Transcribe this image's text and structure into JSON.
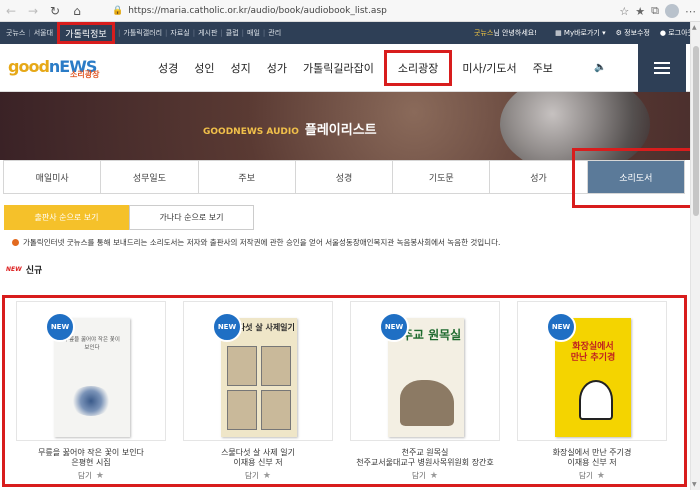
{
  "browser": {
    "url": "https://maria.catholic.or.kr/audio/book/audiobook_list.asp"
  },
  "topbar": {
    "links": [
      "굿뉴스",
      "서울대",
      "",
      "가톨릭갤러리",
      "자료실",
      "게시판",
      "클럽",
      "매일",
      "관리"
    ],
    "highlight": "가톨릭정보",
    "welcome_brand": "굿뉴스",
    "welcome_rest": "님 안녕하세요!",
    "util": [
      "My바로가기",
      "정보수정",
      "로그아웃"
    ]
  },
  "header": {
    "logo_word": "goodnews",
    "logo_sub": "소리광장",
    "menu": [
      "성경",
      "성인",
      "성지",
      "성가",
      "가톨릭길라잡이",
      "소리광장",
      "미사/기도서",
      "주보"
    ],
    "highlighted_menu": "소리광장"
  },
  "banner": {
    "en": "GOODNEWS AUDIO",
    "ko": "플레이리스트"
  },
  "tabs": [
    "매일미사",
    "성무일도",
    "주보",
    "성경",
    "기도문",
    "성가",
    "소리도서"
  ],
  "active_tab": "소리도서",
  "sort": {
    "by_publication": "출판사 순으로 보기",
    "by_alphabet": "가나다 순으로 보기"
  },
  "notice": "가톨릭인터넷 굿뉴스를 통해 보내드리는 소리도서는 저자와 출판사의 저작권에 관한 승인을 얻어 서울성동장애인복지관 녹음봉사회에서 녹음한 것입니다.",
  "section": {
    "badge": "NEW",
    "label": "신규"
  },
  "books": [
    {
      "badge": "NEW",
      "title": "무릎을 꿇어야 작은 꽃이 보인다",
      "author": "은평현 시집",
      "keep": "담기",
      "cover_text": "무릎을 꿇어야 작은 꽃이 보인다"
    },
    {
      "badge": "NEW",
      "title": "스물다섯 살 사제 일기",
      "author": "이재용 신부 저",
      "keep": "담기",
      "cover_text": "스물다섯 살 사제일기"
    },
    {
      "badge": "NEW",
      "title": "천주교 원목실",
      "author": "천주교서울대교구 병원사목위원회 장간호",
      "keep": "담기",
      "cover_text": "천주교 원목실"
    },
    {
      "badge": "NEW",
      "title": "화장실에서 만난 주기경",
      "author": "이재용 신부 저",
      "keep": "담기",
      "cover_text": "화장실에서 만난 추기경"
    }
  ],
  "colors": {
    "navy": "#2e3f56",
    "highlight_red": "#d81d1d",
    "sort_active": "#f5c12a",
    "tab_active": "#5b7a99",
    "new_badge": "#1f6fc4"
  }
}
